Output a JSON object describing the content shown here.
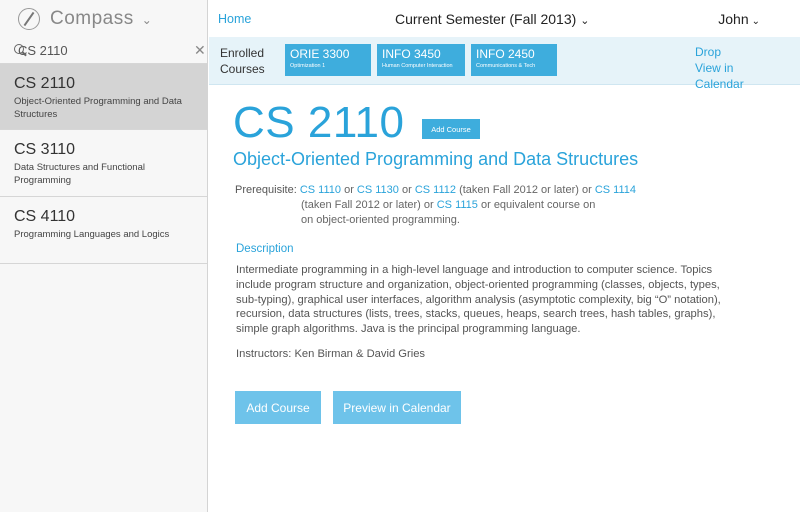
{
  "app": {
    "name": "Compass"
  },
  "search": {
    "value": "CS 2110"
  },
  "course_list": [
    {
      "code": "CS 2110",
      "title": "Object-Oriented Programming and Data Structures"
    },
    {
      "code": "CS 3110",
      "title": "Data Structures and Functional Programming"
    },
    {
      "code": "CS 4110",
      "title": "Programming Languages and Logics"
    }
  ],
  "topbar": {
    "home": "Home",
    "semester": "Current Semester (Fall 2013)",
    "user": "John"
  },
  "enrolled": {
    "label": "Enrolled Courses",
    "courses": [
      {
        "code": "ORIE 3300",
        "subtitle": "Optimization 1"
      },
      {
        "code": "INFO 3450",
        "subtitle": "Human Computer Interaction"
      },
      {
        "code": "INFO 2450",
        "subtitle": "Communications & Tech"
      }
    ],
    "drop": "Drop",
    "view_calendar": "View in Calendar"
  },
  "course": {
    "code": "CS 2110",
    "add_course_small": "Add Course",
    "title": "Object-Oriented Programming and Data Structures",
    "prereq_label": "Prerequisite:",
    "prereq": {
      "l1": "CS 1110",
      "t1": " or ",
      "l2": "CS 1130",
      "t2": " or ",
      "l3": "CS 1112",
      "t3": " (taken Fall 2012 or later) or ",
      "l4": "CS 1114",
      "t4": "(taken Fall 2012 or later) or ",
      "l5": "CS 1115",
      "t5": " or equivalent course on",
      "t6": "on object-oriented programming."
    },
    "description_heading": "Description",
    "description": "Intermediate programming in a high-level language and introduction to computer science. Topics include program structure and organization, object-oriented programming (classes, objects, types, sub-typing), graphical user interfaces, algorithm analysis (asymptotic complexity, big “O” notation), recursion, data structures (lists, trees, stacks, queues, heaps, search trees, hash tables, graphs), simple graph algorithms. Java is the principal programming language.",
    "instructors": "Instructors: Ken Birman & David Gries",
    "add_course_button": "Add Course",
    "preview_button": "Preview in Calendar"
  },
  "colors": {
    "accent": "#2aa3da",
    "pill": "#3eaddd",
    "button": "#6ec3ea",
    "enrolled_bar": "#e6f3f9",
    "selected_item": "#d4d4d4"
  },
  "icons": [
    "compass-icon",
    "chevron-down-icon",
    "search-icon",
    "close-icon"
  ]
}
